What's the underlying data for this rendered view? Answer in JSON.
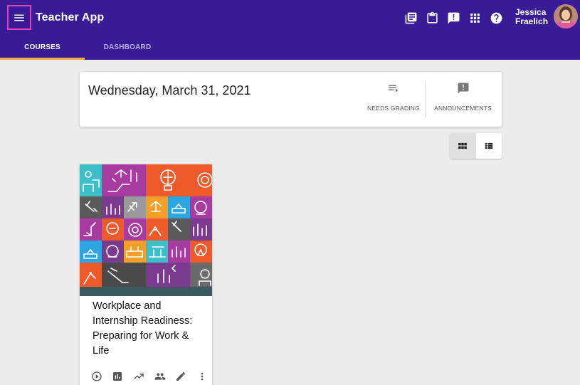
{
  "app": {
    "title": "Teacher App",
    "user": {
      "name": "Jessica Fraelich"
    }
  },
  "colors": {
    "header_bg": "#3a1b96",
    "tab_indicator": "#f3a93b",
    "menu_highlight": "#e040b8"
  },
  "header_icons": [
    "gradebook-icon",
    "clipboard-icon",
    "announcement-icon",
    "apps-grid-icon",
    "help-icon"
  ],
  "tabs": [
    {
      "label": "COURSES",
      "active": true
    },
    {
      "label": "DASHBOARD",
      "active": false
    }
  ],
  "date_card": {
    "date": "Wednesday, March 31, 2021",
    "needs_grading": "NEEDS GRADING",
    "announcements": "ANNOUNCEMENTS"
  },
  "view_toggle": {
    "options": [
      "grid-view-icon",
      "list-view-icon"
    ],
    "selected": "grid"
  },
  "course": {
    "title": "Workplace and Internship Readiness: Preparing for Work & Life",
    "action_icons": [
      "play-icon",
      "reports-icon",
      "analytics-icon",
      "people-icon",
      "edit-icon",
      "more-vert-icon"
    ]
  }
}
